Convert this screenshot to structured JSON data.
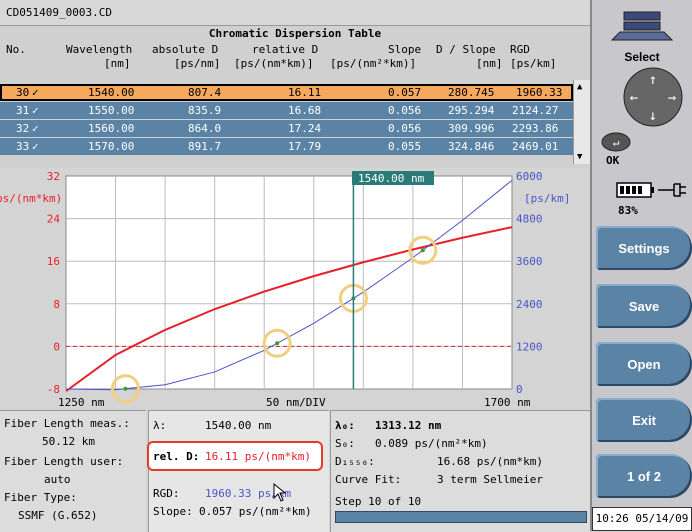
{
  "file_title": "CD051409_0003.CD",
  "table": {
    "title": "Chromatic Dispersion Table",
    "headers": {
      "no": "No.",
      "wavelength": "Wavelength",
      "wavelength_unit": "[nm]",
      "abs_d": "absolute D",
      "abs_d_unit": "[ps/nm]",
      "rel_d": "relative D",
      "rel_d_unit": "[ps/(nm*km)]",
      "slope": "Slope",
      "slope_unit": "[ps/(nm²*km)]",
      "d_slope": "D / Slope",
      "d_slope_unit": "[nm]",
      "rgd": "RGD",
      "rgd_unit": "[ps/km]"
    },
    "rows": [
      {
        "no": "30",
        "check": "✓",
        "wavelength": "1540.00",
        "abs_d": "807.4",
        "rel_d": "16.11",
        "slope": "0.057",
        "d_slope": "280.745",
        "rgd": "1960.33"
      },
      {
        "no": "31",
        "check": "✓",
        "wavelength": "1550.00",
        "abs_d": "835.9",
        "rel_d": "16.68",
        "slope": "0.056",
        "d_slope": "295.294",
        "rgd": "2124.27"
      },
      {
        "no": "32",
        "check": "✓",
        "wavelength": "1560.00",
        "abs_d": "864.0",
        "rel_d": "17.24",
        "slope": "0.056",
        "d_slope": "309.996",
        "rgd": "2293.86"
      },
      {
        "no": "33",
        "check": "✓",
        "wavelength": "1570.00",
        "abs_d": "891.7",
        "rel_d": "17.79",
        "slope": "0.055",
        "d_slope": "324.846",
        "rgd": "2469.01"
      }
    ]
  },
  "chart": {
    "cursor_label": "1540.00 nm",
    "left_axis_label": "ps/(nm*km)",
    "right_axis_label": "[ps/km]",
    "left_ticks": [
      "32",
      "24",
      "16",
      "8",
      "0",
      "-8"
    ],
    "right_ticks": [
      "6000",
      "4800",
      "3600",
      "2400",
      "1200",
      "0"
    ],
    "x_start": "1250 nm",
    "x_div": "50 nm/DIV",
    "x_end": "1700 nm",
    "colors": {
      "dispersion": "#e8202a",
      "rgd": "#4a55c8",
      "grid": "#bbbbbb",
      "cursor": "#2a7a7a",
      "marker": "#f0d080"
    }
  },
  "chart_data": {
    "type": "line",
    "xlim": [
      1250,
      1700
    ],
    "ylim_left": [
      -8,
      32
    ],
    "ylim_right": [
      0,
      6000
    ],
    "series": [
      {
        "axis": "left",
        "x": [
          1250,
          1300,
          1350,
          1400,
          1450,
          1500,
          1550,
          1600,
          1650,
          1700
        ],
        "values": [
          -8.4,
          -1.6,
          3.1,
          7.0,
          10.3,
          13.2,
          15.8,
          18.2,
          20.4,
          22.4
        ]
      },
      {
        "axis": "right",
        "x": [
          1250,
          1300,
          1350,
          1400,
          1450,
          1500,
          1550,
          1600,
          1650,
          1700
        ],
        "values": [
          0,
          -20,
          120,
          480,
          1090,
          1850,
          2730,
          3700,
          4750,
          5880
        ]
      }
    ],
    "markers_x": [
      1310,
      1463,
      1540,
      1610
    ],
    "cursor_x": 1540
  },
  "info_left": {
    "meas_label": "Fiber Length meas.:",
    "meas_value": "50.12 km",
    "user_label": "Fiber Length user:",
    "user_value": "auto",
    "type_label": "Fiber Type:",
    "type_value": "SSMF (G.652)"
  },
  "info_mid": {
    "lambda_label": "λ:",
    "lambda_value": "1540.00 nm",
    "reld_label": "rel. D:",
    "reld_value": "16.11 ps/(nm*km)",
    "rgd_label": "RGD:",
    "rgd_value": "1960.33 ps/km",
    "slope_label": "Slope:",
    "slope_value": "0.057 ps/(nm²*km)"
  },
  "info_right": {
    "l0_label": "λ₀:",
    "l0_value": "1313.12 nm",
    "s0_label": "S₀:",
    "s0_value": "0.089 ps/(nm²*km)",
    "d1550_label": "D₁₅₅₀:",
    "d1550_value": "16.68 ps/(nm*km)",
    "fit_label": "Curve Fit:",
    "fit_value": "3 term Sellmeier",
    "step_text": "Step 10 of 10"
  },
  "right_panel": {
    "select_label": "Select",
    "ok_label": "OK",
    "battery_pct": "83%",
    "buttons": [
      "Settings",
      "Save",
      "Open",
      "Exit",
      "1 of 2"
    ]
  },
  "clock": "10:26 05/14/09"
}
